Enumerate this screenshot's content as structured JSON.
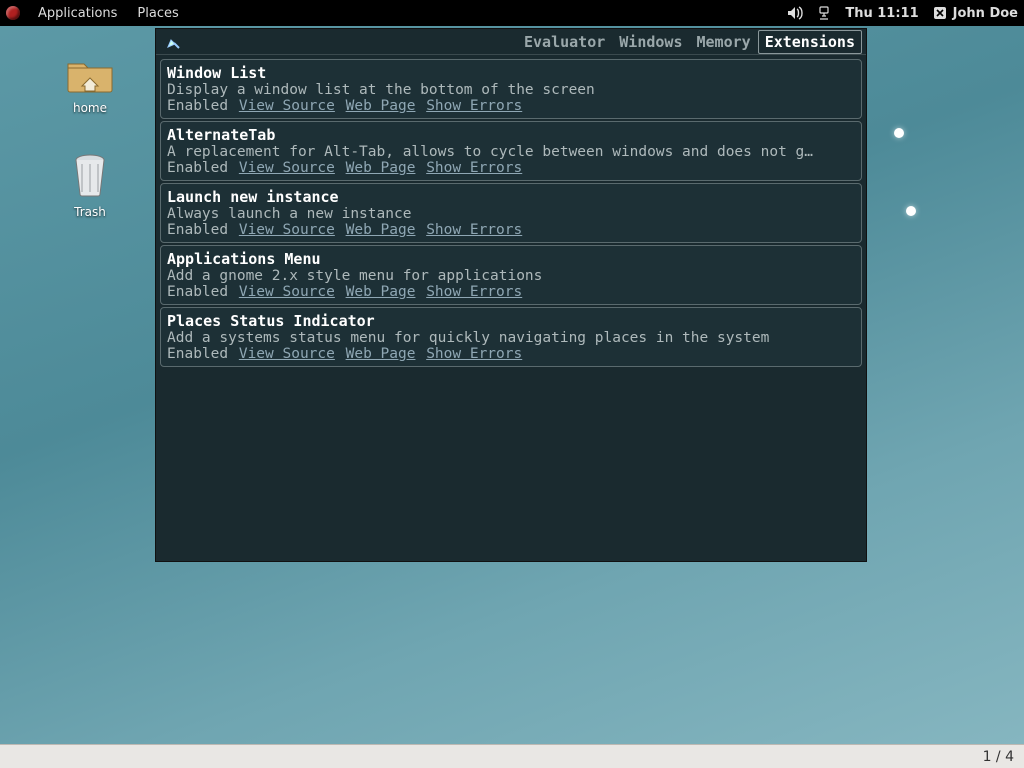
{
  "panel": {
    "menu_applications": "Applications",
    "menu_places": "Places",
    "clock": "Thu 11:11",
    "user_name": "John Doe"
  },
  "desktop": {
    "home_label": "home",
    "trash_label": "Trash"
  },
  "lg": {
    "tabs": {
      "evaluator": "Evaluator",
      "windows": "Windows",
      "memory": "Memory",
      "extensions": "Extensions"
    },
    "link_view_source": "View Source",
    "link_web_page": "Web Page",
    "link_show_errors": "Show Errors",
    "state_enabled": "Enabled",
    "extensions": [
      {
        "name": "Window List",
        "desc": "Display a window list at the bottom of the screen"
      },
      {
        "name": "AlternateTab",
        "desc": "A replacement for Alt-Tab, allows to cycle between windows and does not g…"
      },
      {
        "name": "Launch new instance",
        "desc": "Always launch a new instance"
      },
      {
        "name": "Applications Menu",
        "desc": "Add a gnome 2.x style menu for applications"
      },
      {
        "name": "Places Status Indicator",
        "desc": "Add a systems status menu for quickly navigating places in the system"
      }
    ]
  },
  "bottombar": {
    "workspace": "1 / 4"
  }
}
